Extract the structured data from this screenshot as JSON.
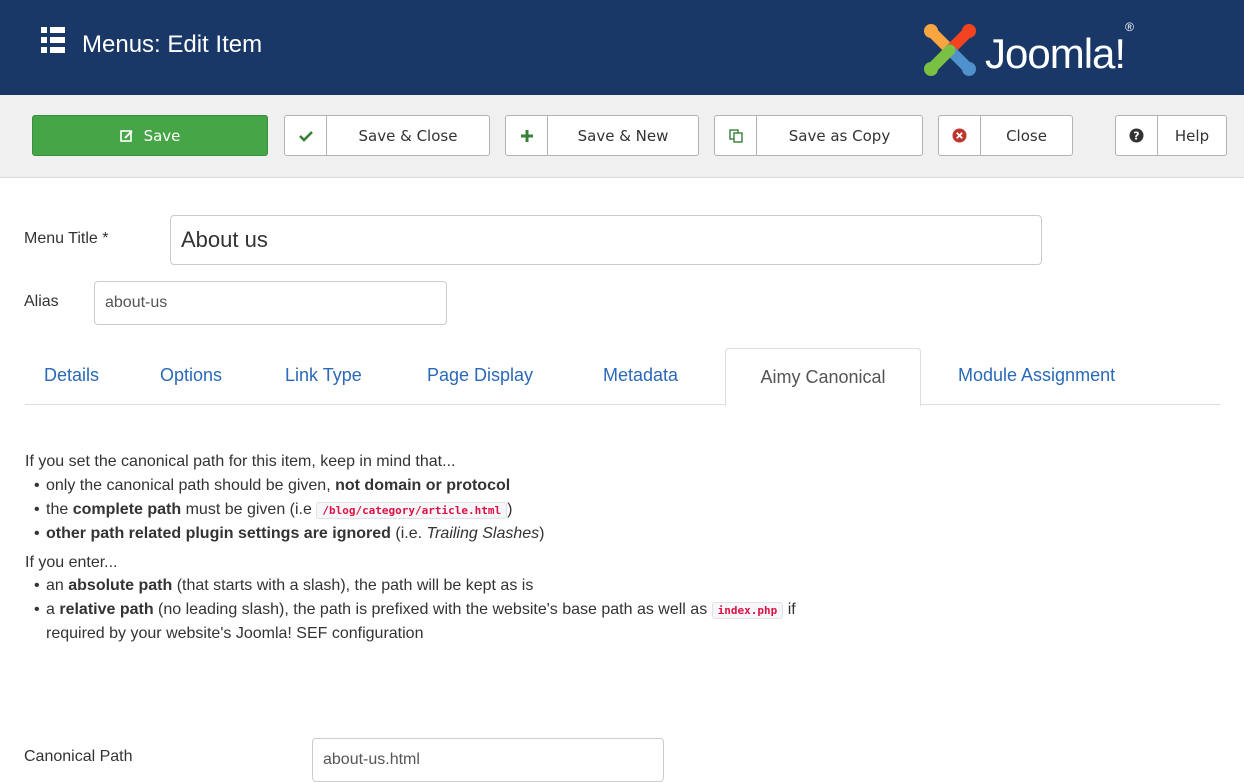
{
  "header": {
    "title": "Menus: Edit Item",
    "brand": "Joomla!",
    "brand_mark": "®"
  },
  "toolbar": {
    "save": "Save",
    "save_close": "Save & Close",
    "save_new": "Save & New",
    "save_copy": "Save as Copy",
    "close": "Close",
    "help": "Help"
  },
  "form": {
    "menu_title_label": "Menu Title *",
    "menu_title_value": "About us",
    "alias_label": "Alias",
    "alias_value": "about-us"
  },
  "tabs": [
    "Details",
    "Options",
    "Link Type",
    "Page Display",
    "Metadata",
    "Aimy Canonical",
    "Module Assignment"
  ],
  "info": {
    "intro": "If you set the canonical path for this item, keep in mind that...",
    "b1_pre": "only the canonical path should be given, ",
    "b1_bold": "not domain or protocol",
    "b2_pre": "the ",
    "b2_bold": "complete path",
    "b2_mid": " must be given (i.e ",
    "b2_code": "/blog/category/article.html",
    "b2_post": ")",
    "b3_bold": "other path related plugin settings are ignored",
    "b3_mid": " (i.e. ",
    "b3_italic": "Trailing Slashes",
    "b3_post": ")",
    "enter": "If you enter...",
    "e1_pre": "an ",
    "e1_bold": "absolute path",
    "e1_post": " (that starts with a slash), the path will be kept as is",
    "e2_pre": "a ",
    "e2_bold": "relative path",
    "e2_mid": " (no leading slash), the path is prefixed with the website's base path as well as ",
    "e2_code": "index.php",
    "e2_post": " if",
    "e2_line2": "required by your website's Joomla! SEF configuration"
  },
  "canonical": {
    "label": "Canonical Path",
    "value": "about-us.html"
  },
  "colors": {
    "header_bg": "#1a3867",
    "save_green": "#46a546",
    "link_blue": "#2a69b8"
  }
}
